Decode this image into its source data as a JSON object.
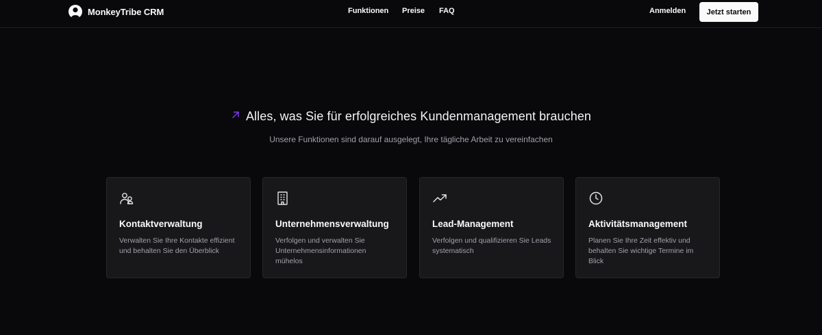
{
  "header": {
    "brand": "MonkeyTribe CRM",
    "nav": [
      "Funktionen",
      "Preise",
      "FAQ"
    ],
    "login": "Anmelden",
    "cta": "Jetzt starten"
  },
  "hero": {
    "title": "Alles, was Sie für erfolgreiches Kundenmanagement brauchen",
    "subtitle": "Unsere Funktionen sind darauf ausgelegt, Ihre tägliche Arbeit zu vereinfachen",
    "accent_color": "#7c3aed"
  },
  "features": [
    {
      "icon": "users-icon",
      "title": "Kontaktverwaltung",
      "description": "Verwalten Sie Ihre Kontakte effizient und behalten Sie den Überblick"
    },
    {
      "icon": "building-icon",
      "title": "Unternehmensverwaltung",
      "description": "Verfolgen und verwalten Sie Unternehmensinformationen mühelos"
    },
    {
      "icon": "trending-up-icon",
      "title": "Lead-Management",
      "description": "Verfolgen und qualifizieren Sie Leads systematisch"
    },
    {
      "icon": "clock-icon",
      "title": "Aktivitätsmanagement",
      "description": "Planen Sie Ihre Zeit effektiv und behalten Sie wichtige Termine im Blick"
    }
  ]
}
